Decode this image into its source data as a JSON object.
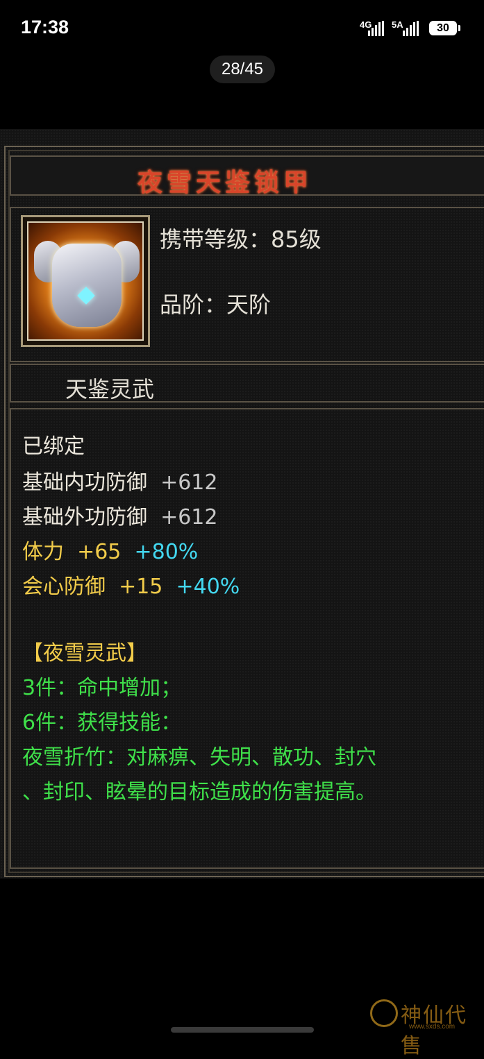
{
  "status_bar": {
    "time": "17:38",
    "network1": "4G",
    "network2": "5A",
    "battery": "30"
  },
  "viewer": {
    "counter": "28/45"
  },
  "item": {
    "name": "夜雪天鉴锁甲",
    "icon": "armor-icon",
    "level_label": "携带等级：85级",
    "grade_label": "品阶：天阶",
    "series": "天鉴灵武",
    "bound": "已绑定",
    "attributes": [
      {
        "name": "基础内功防御",
        "value": "+612",
        "bonus": ""
      },
      {
        "name": "基础外功防御",
        "value": "+612",
        "bonus": ""
      },
      {
        "name": "体力",
        "value": "+65",
        "bonus": "+80%"
      },
      {
        "name": "会心防御",
        "value": "+15",
        "bonus": "+40%"
      }
    ],
    "set": {
      "title": "【夜雪灵武】",
      "lines": [
        "3件：命中增加；",
        "6件：获得技能：",
        "夜雪折竹：对麻痹、失明、散功、封穴",
        "、封印、眩晕的目标造成的伤害提高。"
      ]
    }
  },
  "watermark": {
    "text": "神仙代售",
    "url": "www.sxds.com"
  },
  "colors": {
    "title": "#d9452a",
    "gold": "#f2cc4a",
    "cyan": "#43d8f0",
    "green": "#3fe04a"
  }
}
